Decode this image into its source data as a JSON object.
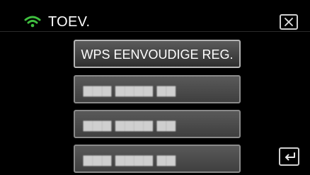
{
  "header": {
    "title": "TOEV.",
    "wifi_icon": "wifi-icon",
    "close_icon": "close-icon",
    "accent_color": "#3fbf3f"
  },
  "menu": {
    "items": [
      {
        "label": "WPS EENVOUDIGE REG."
      },
      {
        "label": "▆▆▆ ▆▆▆▆ ▆▆"
      },
      {
        "label": "▆▆▆ ▆▆▆▆ ▆▆"
      },
      {
        "label": "▆▆▆ ▆▆▆▆ ▆▆"
      }
    ]
  },
  "footer": {
    "back_icon": "return-icon"
  }
}
